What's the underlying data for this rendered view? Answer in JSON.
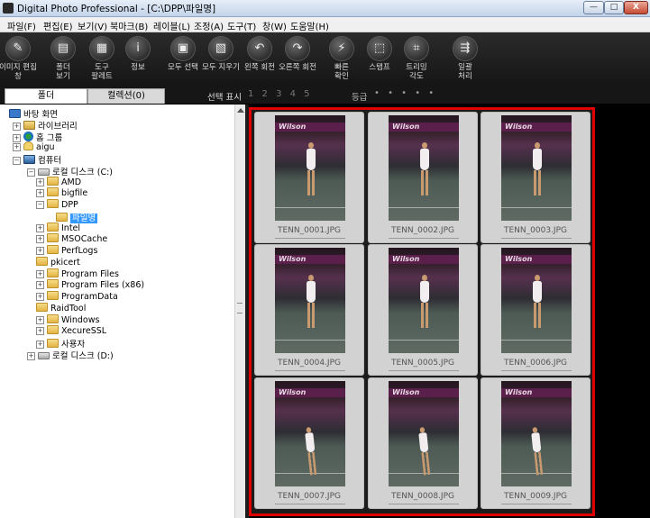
{
  "window": {
    "title": "Digital Photo Professional - [C:\\DPP\\파일명]",
    "controls": {
      "minimize": "—",
      "maximize": "□",
      "close": "X"
    }
  },
  "menu": [
    "파일(F)",
    "편집(E)",
    "보기(V)",
    "북마크(B)",
    "레이블(L)",
    "조정(A)",
    "도구(T)",
    "창(W)",
    "도움말(H)"
  ],
  "toolbar": [
    {
      "label": "이미지 편집\n창",
      "icon": "image-edit-icon",
      "glyph": "✎"
    },
    {
      "label": "폴더\n보기",
      "icon": "folder-view-icon",
      "glyph": "▤"
    },
    {
      "label": "도구\n팔레트",
      "icon": "tool-palette-icon",
      "glyph": "▦"
    },
    {
      "label": "정보",
      "icon": "info-icon",
      "glyph": "i"
    },
    {
      "label": "모두 선택",
      "icon": "select-all-icon",
      "glyph": "▣"
    },
    {
      "label": "모두 지우기",
      "icon": "clear-all-icon",
      "glyph": "▧"
    },
    {
      "label": "왼쪽 회전",
      "icon": "rotate-left-icon",
      "glyph": "↶"
    },
    {
      "label": "오른쪽 회전",
      "icon": "rotate-right-icon",
      "glyph": "↷"
    },
    {
      "label": "빠른\n확인",
      "icon": "quick-check-icon",
      "glyph": "⚡"
    },
    {
      "label": "스탬프",
      "icon": "stamp-icon",
      "glyph": "⬚"
    },
    {
      "label": "트리밍\n각도",
      "icon": "trim-angle-icon",
      "glyph": "⌗"
    },
    {
      "label": "일괄\n처리",
      "icon": "batch-process-icon",
      "glyph": "⇶"
    }
  ],
  "tabs": {
    "folder": "폴더",
    "collection": "컬렉션(0)"
  },
  "selection_bar": {
    "select_label": "선택 표시",
    "numbers": "1 2 3 4 5",
    "grade_label": "등급",
    "grade_dots": "• • • • •"
  },
  "tree": [
    {
      "label": "바탕 화면",
      "icon": "desktop",
      "exp": ""
    },
    {
      "label": "라이브러리",
      "icon": "library",
      "exp": "+"
    },
    {
      "label": "홈 그룹",
      "icon": "homegroup",
      "exp": "+"
    },
    {
      "label": "aigu",
      "icon": "user",
      "exp": "+"
    },
    {
      "label": "컴퓨터",
      "icon": "computer",
      "exp": "−"
    },
    {
      "label": "로컬 디스크 (C:)",
      "icon": "drive",
      "exp": "−"
    },
    {
      "label": "AMD",
      "icon": "folder",
      "exp": "+"
    },
    {
      "label": "bigfile",
      "icon": "folder",
      "exp": "+"
    },
    {
      "label": "DPP",
      "icon": "folder",
      "exp": "−"
    },
    {
      "label": "파일명",
      "icon": "folder",
      "exp": "",
      "selected": true
    },
    {
      "label": "Intel",
      "icon": "folder",
      "exp": "+"
    },
    {
      "label": "MSOCache",
      "icon": "folder",
      "exp": "+"
    },
    {
      "label": "PerfLogs",
      "icon": "folder",
      "exp": "+"
    },
    {
      "label": "pkicert",
      "icon": "folder",
      "exp": ""
    },
    {
      "label": "Program Files",
      "icon": "folder",
      "exp": "+"
    },
    {
      "label": "Program Files (x86)",
      "icon": "folder",
      "exp": "+"
    },
    {
      "label": "ProgramData",
      "icon": "folder",
      "exp": "+"
    },
    {
      "label": "RaidTool",
      "icon": "folder",
      "exp": ""
    },
    {
      "label": "Windows",
      "icon": "folder",
      "exp": "+"
    },
    {
      "label": "XecureSSL",
      "icon": "folder",
      "exp": "+"
    },
    {
      "label": "사용자",
      "icon": "folder",
      "exp": "+"
    },
    {
      "label": "로컬 디스크 (D:)",
      "icon": "drive",
      "exp": "+"
    }
  ],
  "thumbnails": [
    {
      "file": "TENN_0001.JPG"
    },
    {
      "file": "TENN_0002.JPG"
    },
    {
      "file": "TENN_0003.JPG"
    },
    {
      "file": "TENN_0004.JPG"
    },
    {
      "file": "TENN_0005.JPG"
    },
    {
      "file": "TENN_0006.JPG"
    },
    {
      "file": "TENN_0007.JPG"
    },
    {
      "file": "TENN_0008.JPG"
    },
    {
      "file": "TENN_0009.JPG"
    }
  ],
  "photo_banner_text": "Wilson",
  "colors": {
    "selection_border": "#e00000",
    "tree_selected": "#3399ff"
  }
}
